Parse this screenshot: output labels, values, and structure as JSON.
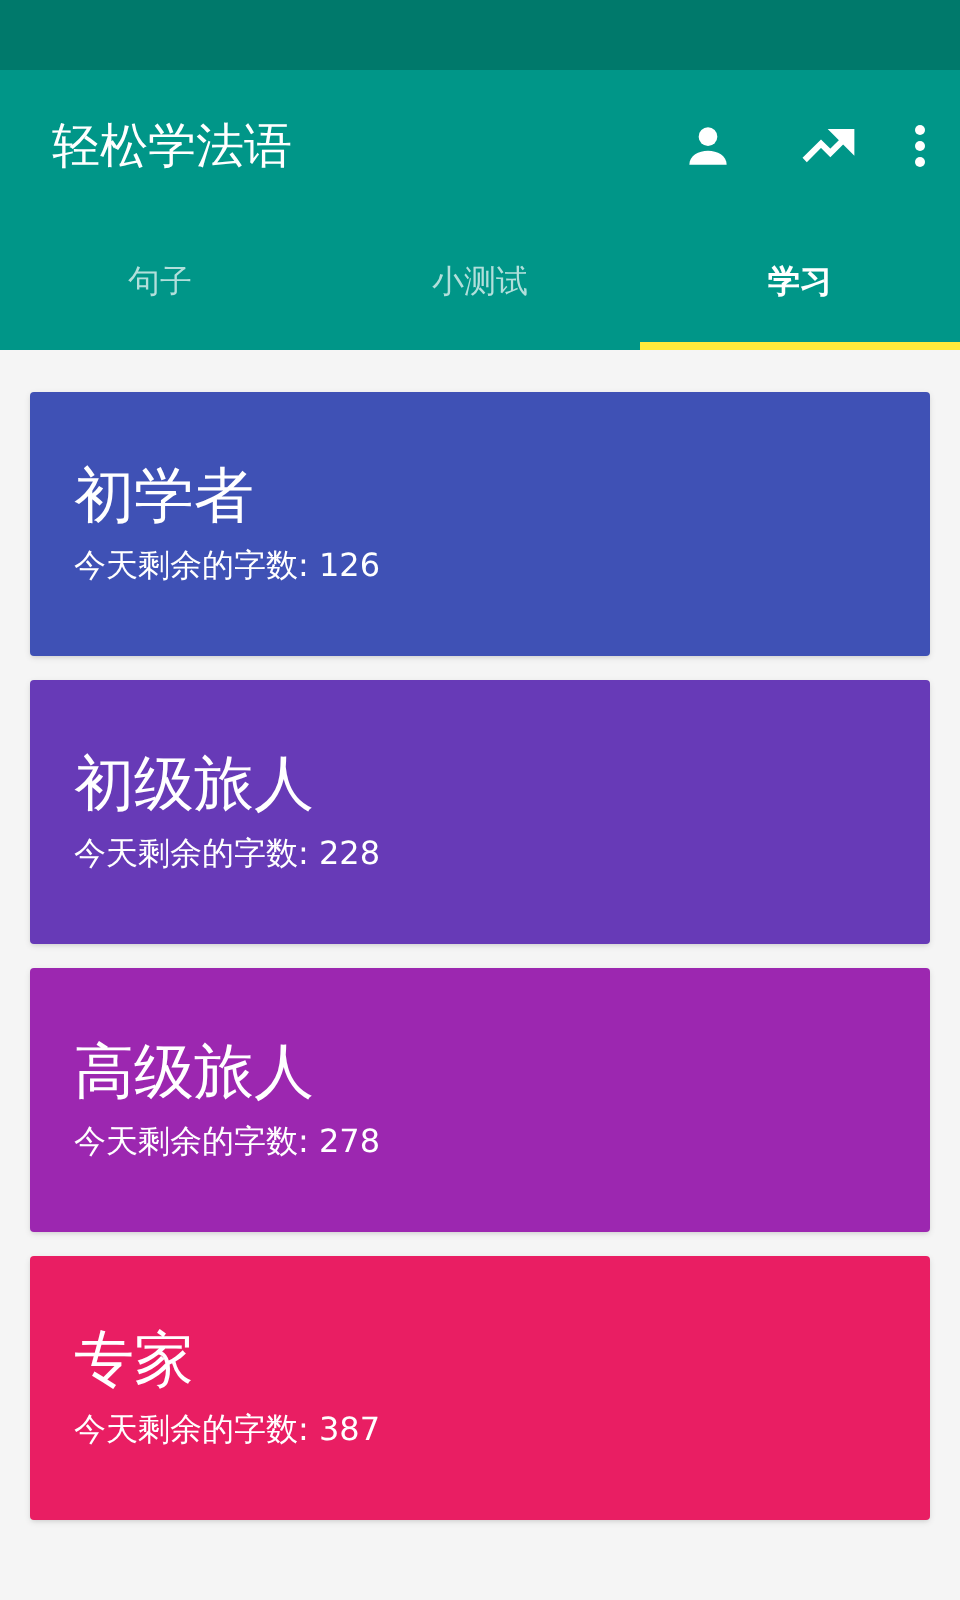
{
  "app_bar": {
    "title": "轻松学法语"
  },
  "tabs": [
    {
      "label": "句子",
      "selected": false
    },
    {
      "label": "小测试",
      "selected": false
    },
    {
      "label": "学习",
      "selected": true
    }
  ],
  "levels": [
    {
      "title": "初学者",
      "subtitle": "今天剩余的字数: 126",
      "color": "#3f51b5"
    },
    {
      "title": "初级旅人",
      "subtitle": "今天剩余的字数: 228",
      "color": "#673ab7"
    },
    {
      "title": "高级旅人",
      "subtitle": "今天剩余的字数: 278",
      "color": "#9c27b0"
    },
    {
      "title": "专家",
      "subtitle": "今天剩余的字数: 387",
      "color": "#e91e63"
    }
  ]
}
